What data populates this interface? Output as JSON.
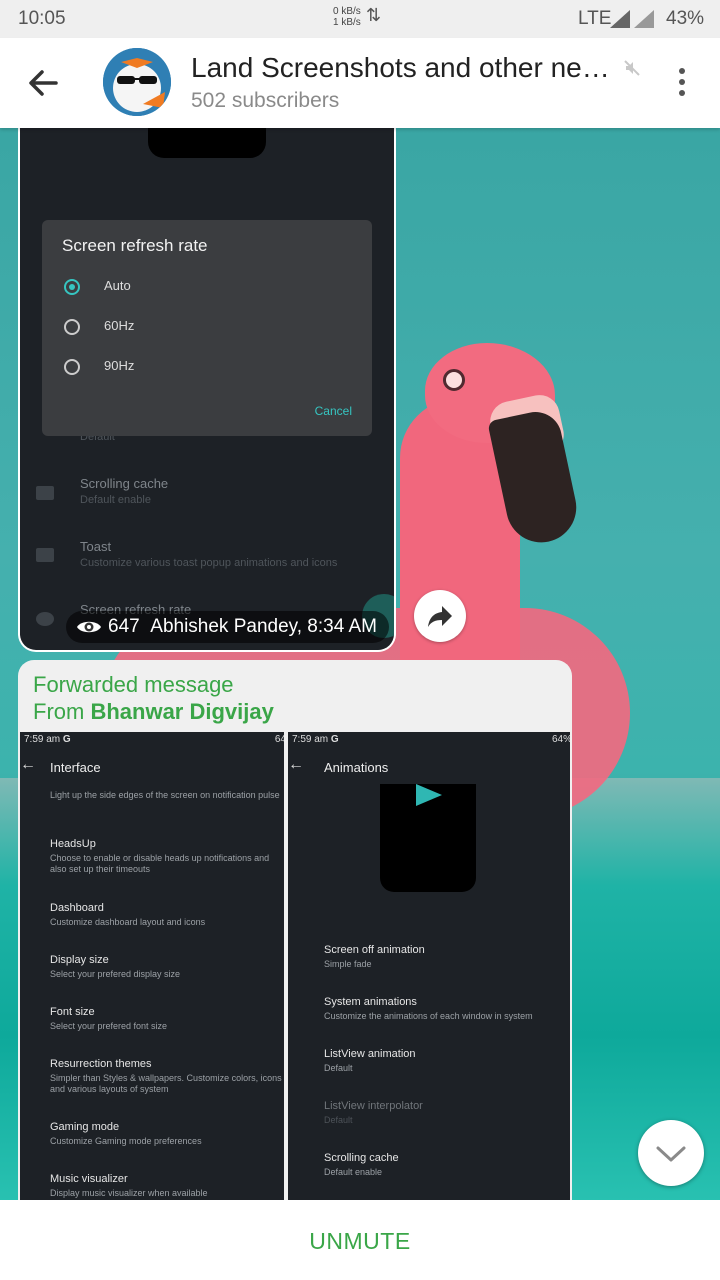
{
  "status_bar": {
    "time": "10:05",
    "net_up": "0 kB/s",
    "net_down": "1 kB/s",
    "network": "LTE",
    "battery": "43%"
  },
  "header": {
    "title": "Land Screenshots and other ne…",
    "subscribers": "502 subscribers"
  },
  "message1": {
    "dialog_title": "Screen refresh rate",
    "options": [
      "Auto",
      "60Hz",
      "90Hz"
    ],
    "selected": "Auto",
    "cancel": "Cancel",
    "rows": [
      {
        "title": "Scrolling cache",
        "subtitle": "Default enable"
      },
      {
        "title": "Toast",
        "subtitle": "Customize various toast popup animations and icons"
      },
      {
        "title": "Screen refresh rate",
        "subtitle": ""
      }
    ],
    "partial_above_dialog": "Default",
    "views": "647",
    "author_time": "Abhishek Pandey, 8:34 AM"
  },
  "message2": {
    "forwarded_label": "Forwarded message",
    "from_prefix": "From ",
    "from_name": "Bhanwar Digvijay",
    "shot_left": {
      "time": "7:59 am",
      "time_letter": "G",
      "battery": "64",
      "title": "Interface",
      "top_text": "Light up the side edges of the screen on notification pulse",
      "items": [
        {
          "title": "HeadsUp",
          "subtitle": "Choose to enable or disable heads up notifications and also set up their timeouts"
        },
        {
          "title": "Dashboard",
          "subtitle": "Customize dashboard layout and icons"
        },
        {
          "title": "Display size",
          "subtitle": "Select your prefered display size"
        },
        {
          "title": "Font size",
          "subtitle": "Select your prefered font size"
        },
        {
          "title": "Resurrection themes",
          "subtitle": "Simpler than Styles & wallpapers. Customize colors, icons and various layouts of system"
        },
        {
          "title": "Gaming mode",
          "subtitle": "Customize Gaming mode preferences"
        },
        {
          "title": "Music visualizer",
          "subtitle": "Display music visualizer when available"
        }
      ]
    },
    "shot_right": {
      "time": "7:59 am",
      "time_letter": "G",
      "battery": "64%",
      "title": "Animations",
      "items": [
        {
          "title": "Screen off animation",
          "subtitle": "Simple fade"
        },
        {
          "title": "System animations",
          "subtitle": "Customize the animations of each window in system"
        },
        {
          "title": "ListView animation",
          "subtitle": "Default"
        },
        {
          "title": "ListView interpolator",
          "subtitle": "Default"
        },
        {
          "title": "Scrolling cache",
          "subtitle": "Default enable"
        }
      ]
    }
  },
  "bottom": {
    "unmute": "UNMUTE"
  },
  "colors": {
    "accent_green": "#3aa648",
    "teal": "#36c5c1"
  }
}
